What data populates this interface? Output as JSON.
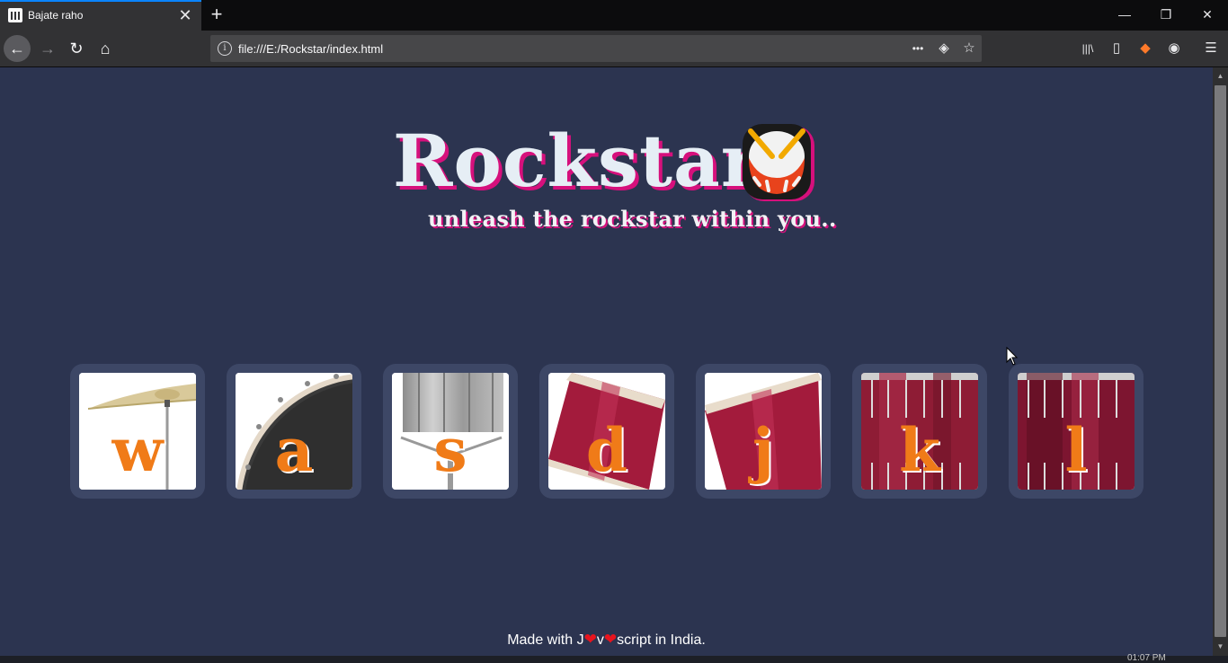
{
  "browser": {
    "tab_title": "Bajate raho",
    "url": "file:///E:/Rockstar/index.html",
    "tab_close_glyph": "✕",
    "new_tab_glyph": "+",
    "window": {
      "minimize": "—",
      "restore": "❐",
      "close": "✕"
    },
    "nav": {
      "back": "←",
      "forward": "→",
      "reload": "↻",
      "home": "⌂"
    },
    "url_actions": {
      "more": "•••",
      "pocket": "◈",
      "bookmark": "☆"
    },
    "toolbar_icons": {
      "library": "|||\\",
      "sidebar": "▯",
      "extension": "◆",
      "account": "◉",
      "menu": "☰"
    }
  },
  "page": {
    "title": "Rockstar",
    "subtitle": "unleash the rockstar within you..",
    "keys": [
      {
        "letter": "w",
        "instrument": "crash-cymbal"
      },
      {
        "letter": "a",
        "instrument": "kick-drum"
      },
      {
        "letter": "s",
        "instrument": "snare-drum"
      },
      {
        "letter": "d",
        "instrument": "tom-1"
      },
      {
        "letter": "j",
        "instrument": "tom-2"
      },
      {
        "letter": "k",
        "instrument": "tom-3"
      },
      {
        "letter": "l",
        "instrument": "tom-4"
      }
    ],
    "footer": {
      "part1": "Made with J",
      "part2": "v",
      "part3": "script in India."
    }
  },
  "taskbar": {
    "clock": "01:07 PM"
  },
  "colors": {
    "background": "#2c3450",
    "key_frame": "#3d4766",
    "letter": "#f07b18",
    "title_shadow": "#d6107c",
    "drum_red": "#a31b3c"
  }
}
